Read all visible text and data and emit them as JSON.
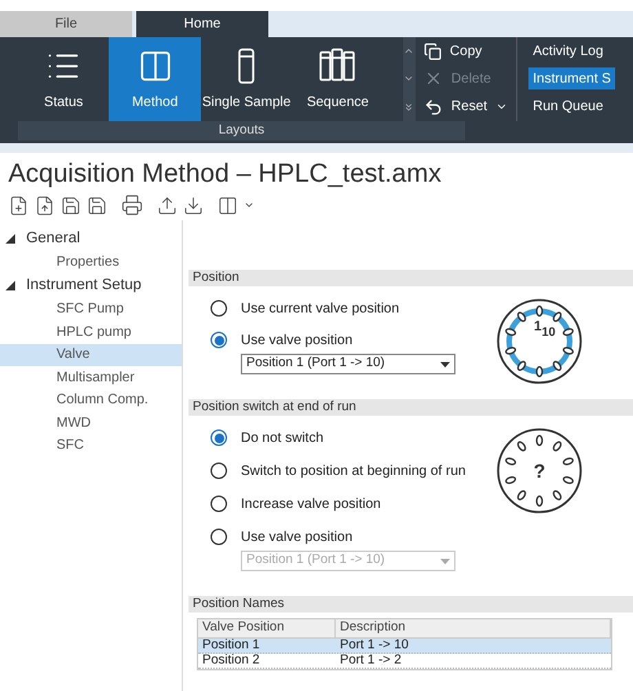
{
  "ribbon_tabs": [
    {
      "label": "File",
      "selected": false
    },
    {
      "label": "Home",
      "selected": true
    }
  ],
  "layout_buttons": [
    {
      "label": "Status",
      "selected": false,
      "kind": "list"
    },
    {
      "label": "Method",
      "selected": true,
      "kind": "method"
    },
    {
      "label": "Single Sample",
      "selected": false,
      "kind": "vial"
    },
    {
      "label": "Sequence",
      "selected": false,
      "kind": "vials"
    }
  ],
  "edit_actions": [
    {
      "label": "Copy",
      "disabled": false,
      "kind": "copy"
    },
    {
      "label": "Delete",
      "disabled": true,
      "kind": "delete"
    },
    {
      "label": "Reset",
      "disabled": false,
      "kind": "reset"
    }
  ],
  "view_list": [
    {
      "label": "Activity Log",
      "selected": false
    },
    {
      "label": "Instrument S",
      "selected": true
    },
    {
      "label": "Run Queue",
      "selected": false
    }
  ],
  "group_label": "Layouts",
  "title": "Acquisition Method – HPLC_test.amx",
  "tree": [
    {
      "label": "General",
      "expanded": true,
      "children": [
        {
          "label": "Properties",
          "selected": false
        }
      ]
    },
    {
      "label": "Instrument Setup",
      "expanded": true,
      "children": [
        {
          "label": "SFC Pump",
          "selected": false
        },
        {
          "label": "HPLC pump",
          "selected": false
        },
        {
          "label": "Valve",
          "selected": true
        },
        {
          "label": "Multisampler",
          "selected": false
        },
        {
          "label": "Column Comp.",
          "selected": false
        },
        {
          "label": "MWD",
          "selected": false
        },
        {
          "label": "SFC",
          "selected": false
        }
      ]
    }
  ],
  "position": {
    "header": "Position",
    "options": [
      {
        "label": "Use current valve position",
        "selected": false
      },
      {
        "label": "Use valve position",
        "selected": true
      }
    ],
    "dropdown": {
      "value": "Position 1 (Port 1 -> 10)",
      "disabled": false
    },
    "valve_labels": [
      "1",
      "10"
    ]
  },
  "end_of_run": {
    "header": "Position switch at end of run",
    "options": [
      {
        "label": "Do not switch",
        "selected": true
      },
      {
        "label": "Switch to position at beginning of run",
        "selected": false
      },
      {
        "label": "Increase valve position",
        "selected": false
      },
      {
        "label": "Use valve position",
        "selected": false
      }
    ],
    "dropdown": {
      "value": "Position 1 (Port 1 -> 10)",
      "disabled": true
    },
    "valve_labels": [
      "?"
    ]
  },
  "position_names": {
    "header": "Position Names",
    "columns": [
      "Valve Position",
      "Description"
    ],
    "rows": [
      {
        "cells": [
          "Position 1",
          "Port 1 -> 10"
        ],
        "selected": true
      },
      {
        "cells": [
          "Position 2",
          "Port 1 -> 2"
        ],
        "selected": false
      }
    ]
  }
}
